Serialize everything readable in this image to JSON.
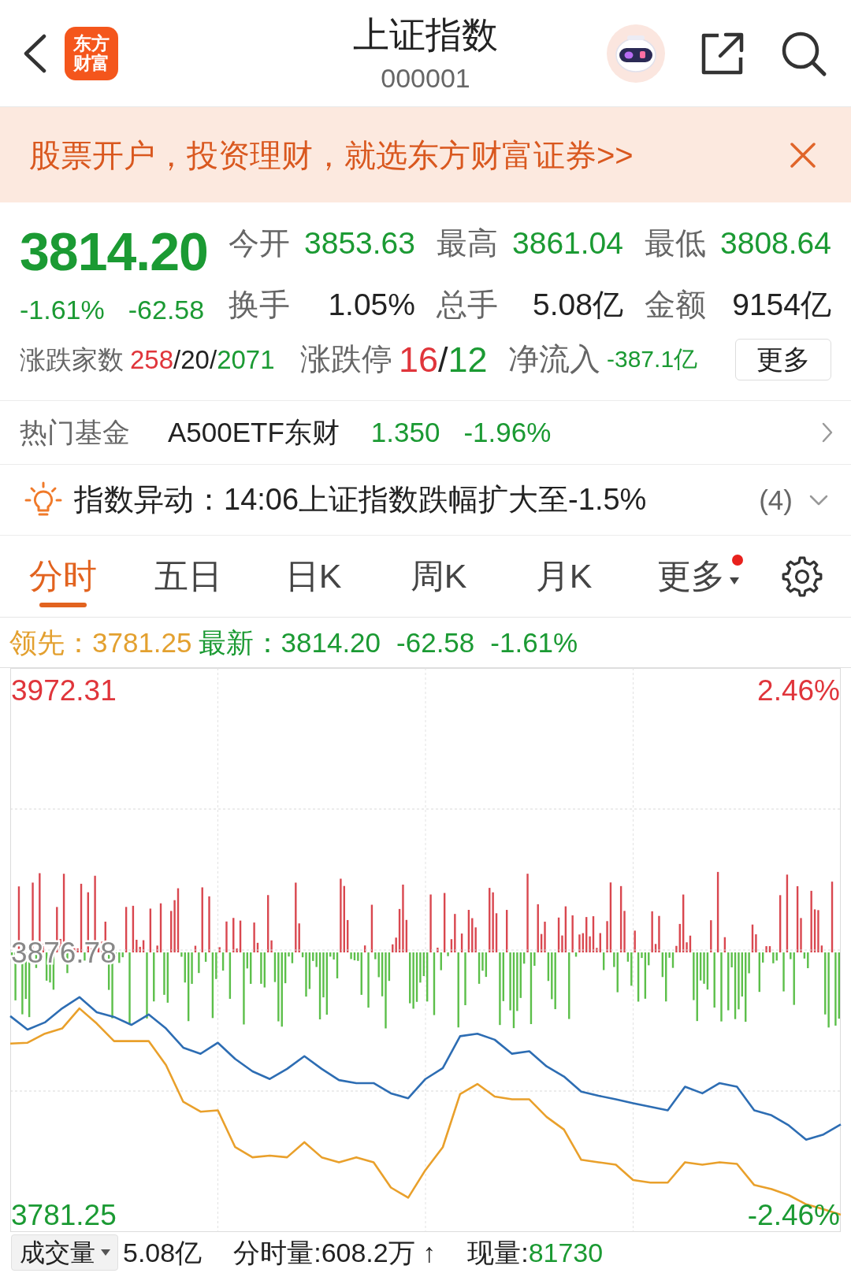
{
  "header": {
    "logo": "东方财富",
    "title": "上证指数",
    "code": "000001"
  },
  "banner": {
    "text": "股票开户，投资理财，就选东方财富证券>>"
  },
  "quote": {
    "price": "3814.20",
    "change_pct": "-1.61%",
    "change": "-62.58",
    "falling": true,
    "stats": [
      {
        "label": "今开",
        "value": "3853.63",
        "color": "#1b9a33"
      },
      {
        "label": "最高",
        "value": "3861.04",
        "color": "#1b9a33"
      },
      {
        "label": "最低",
        "value": "3808.64",
        "color": "#1b9a33"
      },
      {
        "label": "换手",
        "value": "1.05%",
        "color": "#222222"
      },
      {
        "label": "总手",
        "value": "5.08亿",
        "color": "#222222"
      },
      {
        "label": "金额",
        "value": "9154亿",
        "color": "#222222"
      }
    ],
    "breadth": {
      "label": "涨跌家数",
      "parts": [
        {
          "text": "258",
          "color": "#e0353b"
        },
        {
          "text": "/",
          "color": "#222222"
        },
        {
          "text": "20",
          "color": "#222222"
        },
        {
          "text": "/",
          "color": "#222222"
        },
        {
          "text": "2071",
          "color": "#1b9a33"
        }
      ]
    },
    "limits": {
      "label": "涨跌停",
      "parts": [
        {
          "text": "16",
          "color": "#e0353b"
        },
        {
          "text": "/",
          "color": "#222222"
        },
        {
          "text": "12",
          "color": "#1b9a33"
        }
      ]
    },
    "net_inflow": {
      "label": "净流入",
      "value": "-387.1亿",
      "falling": true
    },
    "more_button": "更多"
  },
  "hot_fund": {
    "label": "热门基金",
    "name": "A500ETF东财",
    "price": "1.350",
    "change": "-1.96%",
    "falling": true
  },
  "alert": {
    "text": "指数异动：14:06上证指数跌幅扩大至-1.5%",
    "count": "(4)",
    "expanded": false
  },
  "tabs": [
    {
      "label": "分时",
      "selected": true,
      "kind": "tab",
      "notification": false
    },
    {
      "label": "五日",
      "selected": false,
      "kind": "tab",
      "notification": false
    },
    {
      "label": "日K",
      "selected": false,
      "kind": "tab",
      "notification": false
    },
    {
      "label": "周K",
      "selected": false,
      "kind": "tab",
      "notification": false
    },
    {
      "label": "月K",
      "selected": false,
      "kind": "tab",
      "notification": false
    },
    {
      "label": "更多",
      "selected": false,
      "kind": "menu",
      "notification": true
    }
  ],
  "chart": {
    "legend": [
      {
        "label": "领先：",
        "values": [
          "3781.25"
        ],
        "color": "#e3a02f"
      },
      {
        "label": "最新：",
        "values": [
          "3814.20",
          "-62.58",
          "-1.61%"
        ],
        "color": "#1b9a33"
      }
    ],
    "chart_data": {
      "type": "line",
      "categories": [
        null,
        null,
        null,
        null,
        null,
        null,
        null,
        null,
        null,
        null,
        null,
        null,
        null,
        null,
        null,
        null,
        null,
        null,
        null,
        null,
        null,
        null,
        null,
        null,
        null,
        null,
        null,
        null,
        null,
        null,
        null,
        null,
        null,
        null,
        null,
        null,
        null,
        null,
        null,
        null,
        null,
        null,
        null,
        null,
        null,
        null,
        null,
        null,
        null
      ],
      "ylim": [
        3775.0,
        3980.3
      ],
      "grid": true,
      "yticks": [
        {
          "value": 3972.31,
          "label": "3972.31"
        },
        {
          "value": 3876.78,
          "label": "3876.78"
        },
        {
          "value": 3781.25,
          "label": "3781.25"
        }
      ],
      "series": [
        {
          "color": "#2d6db3",
          "values": [
            3853.6,
            3848.7,
            3851.3,
            3856.4,
            3860.5,
            3855.0,
            3853.3,
            3850.4,
            3854.2,
            3849.1,
            3842.1,
            3839.9,
            3843.9,
            3838.0,
            3833.5,
            3830.7,
            3834.4,
            3839.0,
            3834.4,
            3830.3,
            3829.2,
            3829.2,
            3825.5,
            3823.7,
            3830.7,
            3834.7,
            3846.3,
            3847.2,
            3845.0,
            3839.9,
            3840.8,
            3835.3,
            3831.6,
            3826.1,
            3824.6,
            3823.3,
            3821.9,
            3820.6,
            3819.3,
            3827.9,
            3825.5,
            3829.2,
            3827.9,
            3819.3,
            3817.5,
            3813.8,
            3808.6,
            3810.5,
            3814.2
          ]
        },
        {
          "color": "#e9a02b",
          "values": [
            3843.6,
            3843.9,
            3847.2,
            3849.1,
            3856.4,
            3850.9,
            3844.5,
            3844.5,
            3844.5,
            3835.8,
            3822.4,
            3818.8,
            3819.3,
            3805.9,
            3802.2,
            3802.8,
            3802.2,
            3807.7,
            3802.2,
            3800.4,
            3802.2,
            3800.4,
            3791.2,
            3787.5,
            3797.6,
            3805.9,
            3825.2,
            3828.9,
            3824.3,
            3823.3,
            3823.3,
            3816.9,
            3812.3,
            3801.3,
            3800.4,
            3799.5,
            3793.9,
            3793.0,
            3793.0,
            3800.4,
            3799.5,
            3800.4,
            3799.8,
            3792.1,
            3790.6,
            3788.4,
            3785.1,
            3783.3,
            3781.3
          ]
        }
      ]
    },
    "percent_labels": [
      {
        "text": "2.46%",
        "falling": false
      },
      {
        "text": "-2.46%",
        "falling": true
      }
    ]
  },
  "volume_bar": {
    "selector": "成交量",
    "total": "5.08亿",
    "stats": [
      {
        "label": "分时量:",
        "value": "608.2万 ↑",
        "color": "#222222"
      },
      {
        "label": "现量:",
        "value": "81730",
        "color": "#1b9a33"
      }
    ]
  }
}
